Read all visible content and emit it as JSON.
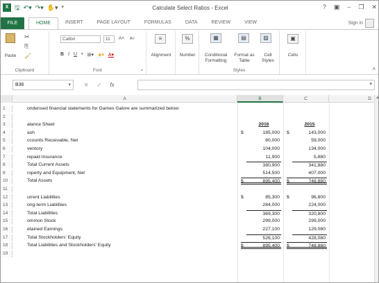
{
  "window": {
    "title": "Calculate Select Ratios - Excel",
    "logo": "X",
    "help": "?",
    "ribbon_opts": "▣",
    "min": "–",
    "max": "❐",
    "close": "✕"
  },
  "tabs": {
    "file": "FILE",
    "items": [
      "HOME",
      "INSERT",
      "PAGE LAYOUT",
      "FORMULAS",
      "DATA",
      "REVIEW",
      "VIEW"
    ],
    "signin": "Sign in"
  },
  "ribbon": {
    "clipboard": {
      "paste": "Paste",
      "label": "Clipboard"
    },
    "font": {
      "name": "Calibri",
      "size": "11",
      "label": "Font",
      "bold": "B",
      "italic": "I",
      "underline": "U"
    },
    "alignment": {
      "label": "Alignment"
    },
    "number": {
      "label": "Number",
      "icon": "%"
    },
    "styles": {
      "conditional": "Conditional",
      "conditional2": "Formatting",
      "format_as": "Format as",
      "format_as2": "Table",
      "cell": "Cell",
      "cell2": "Styles",
      "label": "Styles"
    },
    "cells": {
      "label": "Cells"
    }
  },
  "formula_bar": {
    "name_box": "B36",
    "cancel": "✕",
    "enter": "✓",
    "fx": "fx",
    "value": ""
  },
  "grid": {
    "columns": [
      "A",
      "B",
      "C",
      "D"
    ],
    "rows": [
      {
        "n": "1",
        "a": "ondensed financial statements for Games Galore are summarized below:",
        "bd": "",
        "b": "",
        "cd": "",
        "c": ""
      },
      {
        "n": "2",
        "a": "",
        "bd": "",
        "b": "",
        "cd": "",
        "c": ""
      },
      {
        "n": "3",
        "a": "alance Sheet",
        "bd": "",
        "b": "2016",
        "cd": "",
        "c": "2015"
      },
      {
        "n": "4",
        "a": "ash",
        "bd": "$",
        "b": "185,000",
        "cd": "$",
        "c": "143,000"
      },
      {
        "n": "5",
        "a": "ccounts Receivable, Net",
        "bd": "",
        "b": "80,000",
        "cd": "",
        "c": "59,000"
      },
      {
        "n": "6",
        "a": "ventory",
        "bd": "",
        "b": "104,000",
        "cd": "",
        "c": "134,000"
      },
      {
        "n": "7",
        "a": "repaid Insurance",
        "bd": "",
        "b": "11,900",
        "cd": "",
        "c": "5,880"
      },
      {
        "n": "8",
        "a": "Total Current Assets",
        "bd": "",
        "b": "380,900",
        "cd": "",
        "c": "341,880"
      },
      {
        "n": "9",
        "a": "roperty and Equipment, Net",
        "bd": "",
        "b": "514,500",
        "cd": "",
        "c": "407,000"
      },
      {
        "n": "10",
        "a": "Total Assets",
        "bd": "$",
        "b": "895,400",
        "cd": "$",
        "c": "748,880"
      },
      {
        "n": "11",
        "a": "",
        "bd": "",
        "b": "",
        "cd": "",
        "c": ""
      },
      {
        "n": "12",
        "a": "urrent Liabilities",
        "bd": "$",
        "b": "85,300",
        "cd": "$",
        "c": "96,800"
      },
      {
        "n": "13",
        "a": "ong-term Liabilities",
        "bd": "",
        "b": "284,000",
        "cd": "",
        "c": "224,000"
      },
      {
        "n": "14",
        "a": "Total Liabilities",
        "bd": "",
        "b": "369,300",
        "cd": "",
        "c": "320,800"
      },
      {
        "n": "15",
        "a": "ommon Stock",
        "bd": "",
        "b": "299,000",
        "cd": "",
        "c": "299,000"
      },
      {
        "n": "16",
        "a": "etained Earnings",
        "bd": "",
        "b": "227,100",
        "cd": "",
        "c": "129,080"
      },
      {
        "n": "17",
        "a": "Total Stockholders' Equity",
        "bd": "",
        "b": "526,100",
        "cd": "",
        "c": "428,080"
      },
      {
        "n": "18",
        "a": "Total Liabilities and Stockholders' Equity",
        "bd": "$",
        "b": "895,400",
        "cd": "$",
        "c": "748,880"
      },
      {
        "n": "19",
        "a": "",
        "bd": "",
        "b": "",
        "cd": "",
        "c": ""
      }
    ]
  }
}
